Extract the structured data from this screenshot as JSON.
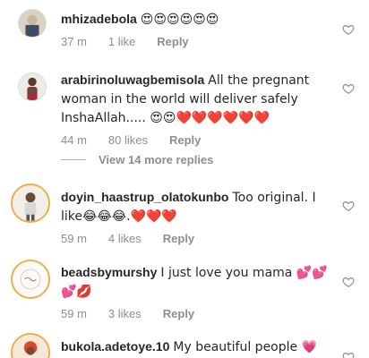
{
  "comments": [
    {
      "username": "mhizadebola",
      "text": "😍😍😍😍😍😍",
      "time": "37 m",
      "likes": "1 like",
      "reply": "Reply"
    },
    {
      "username": "arabirinoluwagbemisola",
      "text": "All the pregnant woman in the world will deliver safely InshaAllah..... 😍😍❤️❤️❤️❤️❤️❤️",
      "time": "44 m",
      "likes": "80 likes",
      "reply": "Reply"
    },
    {
      "username": "doyin_haastrup_olatokunbo",
      "text": "Too original. I like😂😂😂.❤️❤️❤️",
      "time": "59 m",
      "likes": "4 likes",
      "reply": "Reply"
    },
    {
      "username": "beadsbymurshy",
      "text": "I just love you mama 💕💕💕💋",
      "time": "59 m",
      "likes": "3 likes",
      "reply": "Reply"
    },
    {
      "username": "bukola.adetoye.10",
      "text": "My beautiful people 💗"
    }
  ],
  "view_more": "View 14 more replies",
  "icons": {
    "like": "heart-outline-icon"
  },
  "colors": {
    "meta": "#8e8e8e",
    "story_ring": "#e8b04a"
  }
}
